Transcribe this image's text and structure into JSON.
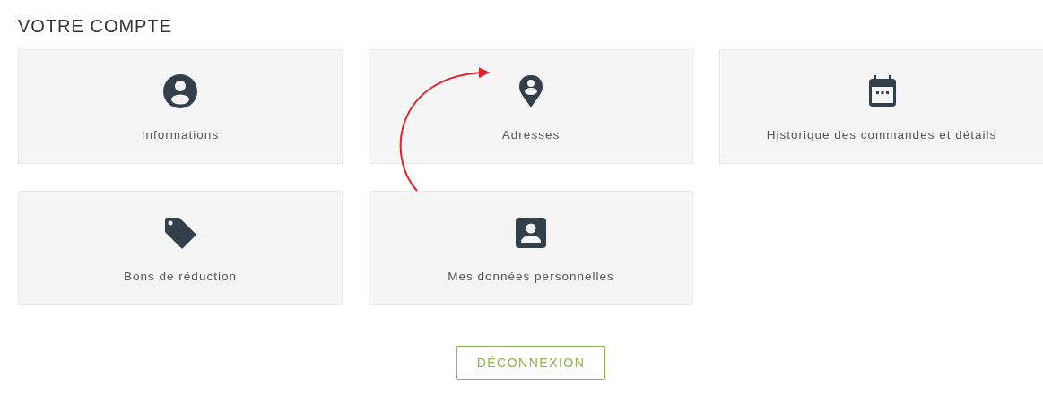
{
  "title": "VOTRE COMPTE",
  "cards": [
    {
      "kind": "profile",
      "label": "Informations"
    },
    {
      "kind": "address",
      "label": "Adresses"
    },
    {
      "kind": "history",
      "label": "Historique des commandes et détails"
    },
    {
      "kind": "voucher",
      "label": "Bons de réduction"
    },
    {
      "kind": "personal-data",
      "label": "Mes données personnelles"
    }
  ],
  "logout_button": "DÉCONNEXION"
}
